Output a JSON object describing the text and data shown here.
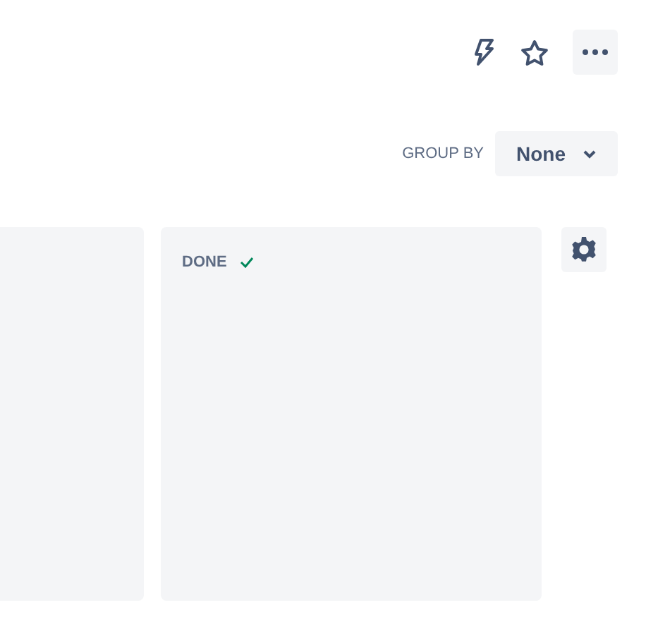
{
  "group_by": {
    "label": "GROUP BY",
    "value": "None"
  },
  "columns": [
    {
      "title": "DONE",
      "done": true
    }
  ]
}
